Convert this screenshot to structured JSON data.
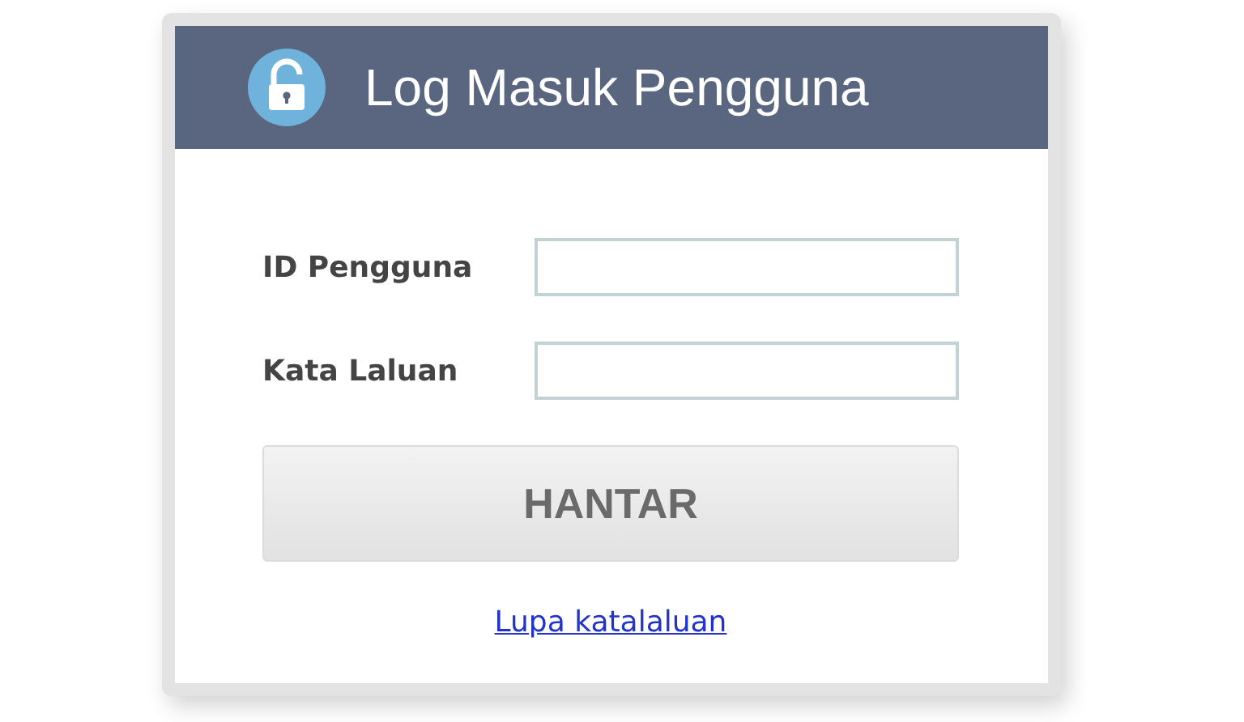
{
  "header": {
    "title": "Log Masuk Pengguna"
  },
  "fields": [
    {
      "label": "ID Pengguna"
    },
    {
      "label": "Kata Laluan"
    }
  ],
  "submit_button": {
    "label": "HANTAR"
  },
  "forgot_link": {
    "label": "Lupa katalaluan"
  }
}
